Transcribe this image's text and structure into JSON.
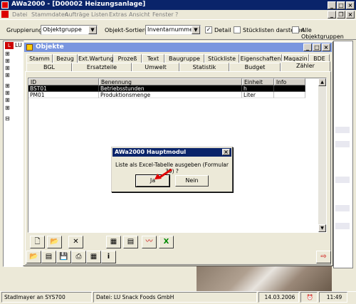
{
  "app": {
    "title": "AWa2000 - [D00002 Heizungsanlage]",
    "menu": [
      "Datei",
      "Stammdaten",
      "Aufträge",
      "Listen",
      "Extras",
      "Ansicht",
      "Fenster",
      "?"
    ]
  },
  "filter": {
    "grouping_label": "Gruppierung",
    "grouping_value": "Objektgruppe",
    "sort_label": "Objekt-Sortierung",
    "sort_value": "Inventarnummer",
    "detail_label": "Detail",
    "detail_checked": true,
    "stuecklisten_label": "Stücklisten darstellen",
    "stuecklisten_checked": false,
    "alle_label": "Alle Objektgruppen",
    "alle_checked": false
  },
  "background_left": {
    "logo_text": "LU"
  },
  "objekte": {
    "title": "Objekte",
    "tabs_row1": [
      "Stamm",
      "Bezug",
      "Ext.Wartung",
      "Prozeß",
      "Text",
      "Baugruppe",
      "Stückliste",
      "Eigenschaften",
      "Magazin",
      "BDE"
    ],
    "tabs_row2": [
      "BGL",
      "Ersatzteile",
      "Umwelt",
      "Statistik",
      "Budget",
      "Zähler"
    ],
    "active_tab": "Zähler",
    "table": {
      "headers": [
        "ID",
        "Benennung",
        "Einheit",
        "Info"
      ],
      "rows": [
        [
          "BST01",
          "Betriebsstunden",
          "h",
          ""
        ],
        [
          "PM01",
          "Produktionsmenge",
          "Liter",
          ""
        ]
      ]
    }
  },
  "dialog": {
    "title": "AWa2000 Hauptmodul",
    "message": "Liste als Excel-Tabelle ausgeben (Formular 39) ?",
    "yes_label": "Ja",
    "no_label": "Nein"
  },
  "statusbar": {
    "user": "Stadlmayer an SYS700",
    "file": "Datei: LU Snack Foods GmbH",
    "date": "14.03.2006",
    "time": "11:49"
  },
  "colors": {
    "titlebar_active": "#0a246a",
    "selection": "#000000",
    "arrow": "#e00000"
  }
}
